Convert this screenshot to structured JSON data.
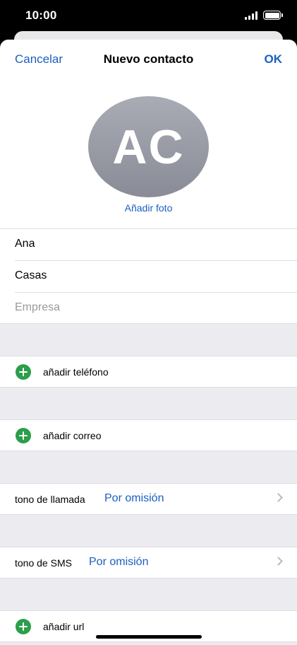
{
  "status_bar": {
    "time": "10:00"
  },
  "nav": {
    "cancel": "Cancelar",
    "title": "Nuevo contacto",
    "ok": "OK"
  },
  "avatar": {
    "initials": "AC",
    "add_photo": "Añadir foto"
  },
  "fields": [
    {
      "value": "Ana",
      "placeholder": ""
    },
    {
      "value": "Casas",
      "placeholder": ""
    },
    {
      "value": "",
      "placeholder": "Empresa"
    }
  ],
  "rows": {
    "add_phone": "añadir teléfono",
    "add_email": "añadir correo",
    "ringtone_label": "tono de llamada",
    "ringtone_value": "Por omisión",
    "sms_label": "tono de SMS",
    "sms_value": "Por omisión",
    "add_url": "añadir url"
  },
  "colors": {
    "accent": "#1a5fc0",
    "add_green": "#2b9e4a",
    "grouped_bg": "#ebebf0"
  }
}
